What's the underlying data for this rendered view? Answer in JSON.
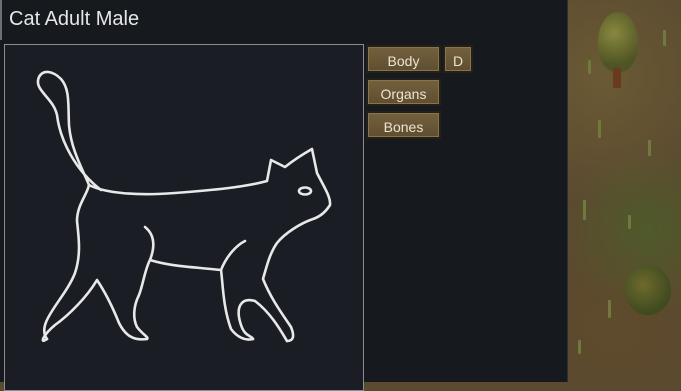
{
  "window": {
    "title": "Cat Adult Male"
  },
  "tabs": {
    "body_label": "Body",
    "d_label": "D",
    "organs_label": "Organs",
    "bones_label": "Bones"
  },
  "colors": {
    "panel_background": "#16191e",
    "button_fill": "#6a5737",
    "outline_stroke": "#e8e8e8"
  },
  "icons": {
    "creature": "cat-outline-icon"
  }
}
